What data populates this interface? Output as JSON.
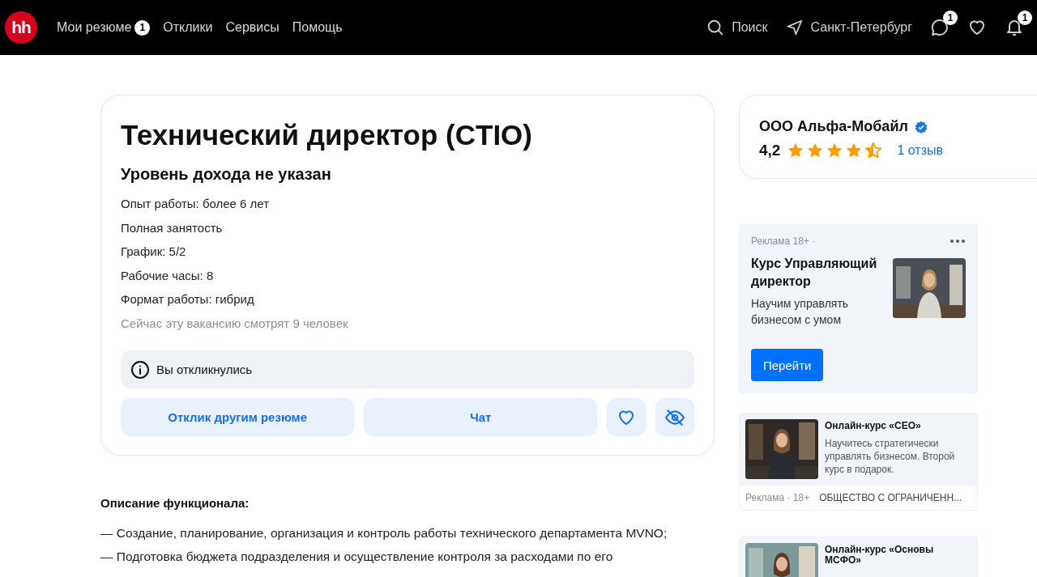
{
  "header": {
    "logo": "hh",
    "nav": [
      {
        "label": "Мои резюме",
        "badge": "1"
      },
      {
        "label": "Отклики"
      },
      {
        "label": "Сервисы"
      },
      {
        "label": "Помощь"
      }
    ],
    "search": "Поиск",
    "location": "Санкт-Петербург",
    "icons": [
      {
        "kind": "chat",
        "badge": "1"
      },
      {
        "kind": "heart"
      },
      {
        "kind": "bell",
        "badge": "1"
      }
    ]
  },
  "vacancy": {
    "title": "Технический директор (CTIO)",
    "salary": "Уровень дохода не указан",
    "details": [
      "Опыт работы: более 6 лет",
      "Полная занятость",
      "График: 5/2",
      "Рабочие часы: 8",
      "Формат работы: гибрид"
    ],
    "viewers": "Сейчас эту вакансию смотрят 9 человек",
    "notice": "Вы откликнулись",
    "buttons": [
      {
        "kind": "text",
        "label": "Отклик другим резюме"
      },
      {
        "kind": "text",
        "label": "Чат"
      },
      {
        "kind": "heart"
      },
      {
        "kind": "hide"
      }
    ]
  },
  "description": {
    "heading": "Описание функционала:",
    "items": [
      "— Создание, планирование, организация и контроль работы технического департамента MVNO;",
      "— Подготовка бюджета подразделения и осуществление контроля за расходами по его"
    ]
  },
  "employer": {
    "name": "ООО Альфа-Мобайл",
    "verified": true,
    "rating": "4,2",
    "stars": 4.5,
    "reviews": "1 отзыв"
  },
  "ads": [
    {
      "kind": "banner",
      "label": "Реклама 18+ ·",
      "title": "Курс Управляющий директор",
      "text": "Научим управлять бизнесом с умом",
      "button": "Перейти"
    },
    {
      "kind": "card",
      "title": "Онлайн-курс «СЕО»",
      "text": "Научитесь стратегически управлять бизнесом. Второй курс в подарок.",
      "label": "Реклама · 18+",
      "advertiser": "ОБЩЕСТВО С ОГРАНИЧЕНН..."
    },
    {
      "kind": "card",
      "title": "Онлайн-курс «Основы МСФО»"
    }
  ]
}
